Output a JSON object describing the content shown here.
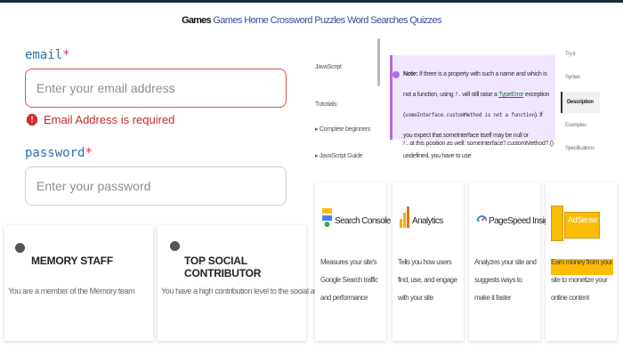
{
  "nav": {
    "brand": "Games",
    "links": [
      "Games",
      "Home",
      "Crossword Puzzles",
      "Word Searches",
      "Quizzes"
    ]
  },
  "form": {
    "email_label": "email",
    "email_required": "*",
    "email_placeholder": "Enter your email address",
    "email_error": "Email Address is required",
    "password_label": "password",
    "password_required": "*",
    "password_placeholder": "Enter your password"
  },
  "badges": [
    {
      "title": "MEMORY STAFF",
      "desc": "You are a member of the Memory team"
    },
    {
      "title": "TOP SOCIAL CONTRIBUTOR",
      "desc": "You have a high contribution level to the social aspects"
    }
  ],
  "doc": {
    "sidebar": [
      "JavaScript",
      "Tutorials:",
      "▸ Complete beginners",
      "▸ JavaScript Guide"
    ],
    "note_prefix": "Note:",
    "note_text_1": "If there is a property with such a name and which is not a function, using",
    "note_code_1": "?.",
    "note_text_2": "will still raise a",
    "note_link": "TypeError",
    "note_text_3": "exception (",
    "note_code_2": "someInterface.customMethod is not a function",
    "note_text_4": "). If you expect that someInterface itself may be null or undefined, you have to use",
    "note_code_3": "?.",
    "note_text_5": "at this position as well: someInterface?.customMethod?.()",
    "right_nav": [
      "Try it",
      "Syntax",
      "Description",
      "Examples",
      "Specifications"
    ],
    "right_nav_active": "Description"
  },
  "tools": [
    {
      "name": "Search Console",
      "desc": "Measures your site's Google Search traffic and performance",
      "icon": "search-console-icon"
    },
    {
      "name": "Analytics",
      "desc": "Tells you how users find, use, and engage with your site",
      "icon": "analytics-icon"
    },
    {
      "name": "PageSpeed Insights",
      "desc": "Analyzes your site and suggests ways to make it faster",
      "icon": "pagespeed-icon"
    },
    {
      "name": "AdSense",
      "desc": "Earn money from your site to monetize your online content",
      "icon": "adsense-icon"
    }
  ],
  "colors": {
    "label": "#2f6fae",
    "required": "#e0334c",
    "error": "#c62828",
    "note_bg": "#f1e6ff",
    "note_border": "#b26ae0",
    "adsense_yellow": "#fbbc04"
  }
}
